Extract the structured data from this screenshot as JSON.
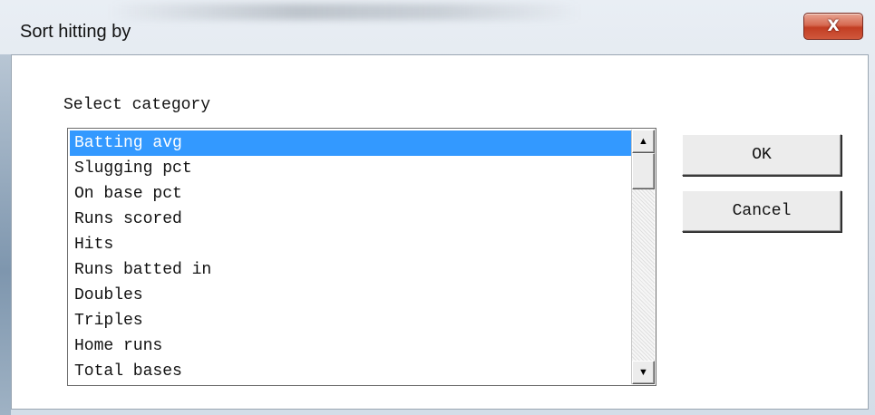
{
  "window": {
    "title": "Sort hitting by",
    "close_icon": "close-x-icon",
    "close_glyph": "X"
  },
  "dialog": {
    "category_label": "Select category",
    "items": [
      "Batting avg",
      "Slugging pct",
      "On base pct",
      "Runs scored",
      "Hits",
      "Runs batted in",
      "Doubles",
      "Triples",
      "Home runs",
      "Total bases"
    ],
    "selected_index": 0,
    "ok_label": "OK",
    "cancel_label": "Cancel"
  },
  "colors": {
    "selection": "#3399ff",
    "close_button": "#c23d23"
  }
}
